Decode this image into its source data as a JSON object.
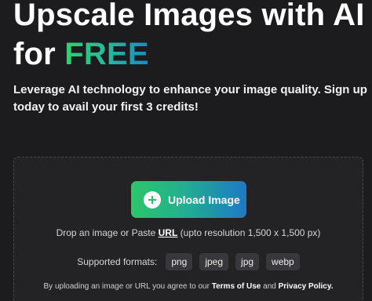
{
  "hero": {
    "title_line1": "Upscale Images with AI",
    "title_for": "for ",
    "title_free": "FREE",
    "subtitle": "Leverage AI technology to enhance your image quality. Sign up today to avail your first 3 credits!"
  },
  "dropzone": {
    "upload_button": {
      "label": "Upload Image",
      "icon": "plus-circle-icon"
    },
    "drop_prefix": "Drop an image or Paste ",
    "url_link": "URL",
    "drop_suffix": " (upto resolution 1,500 x 1,500 px)",
    "formats_label": "Supported formats:",
    "formats": [
      "png",
      "jpeg",
      "jpg",
      "webp"
    ],
    "terms_prefix": "By uploading an image or URL you agree to our ",
    "terms_link": "Terms of Use",
    "terms_and": " and ",
    "privacy_link": "Privacy Policy."
  },
  "colors": {
    "background": "#1c1c1e",
    "panel": "#232325",
    "gradient_start": "#2cc66a",
    "gradient_end": "#1f78c6"
  }
}
